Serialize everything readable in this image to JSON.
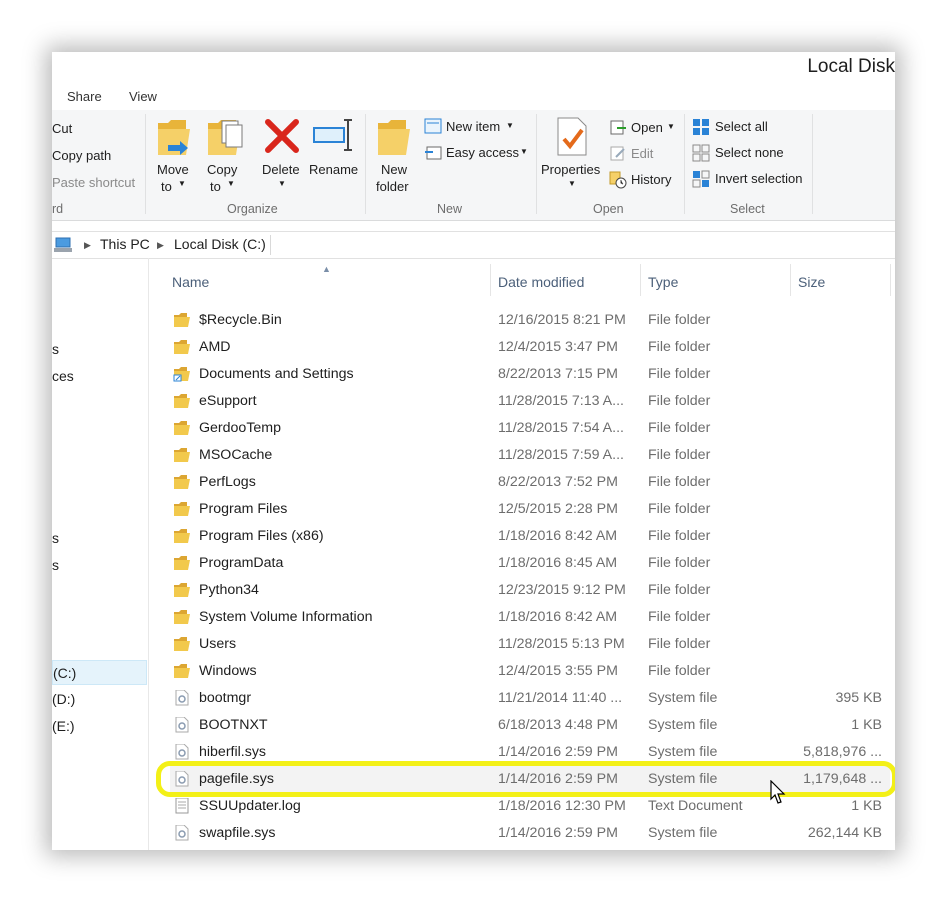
{
  "window": {
    "title": "Local Disk"
  },
  "tabs": [
    "Share",
    "View"
  ],
  "ribbon": {
    "clipboard": {
      "cut": "Cut",
      "copy_path": "Copy path",
      "paste_shortcut": "Paste shortcut",
      "group_label_fragment": "rd"
    },
    "organize": {
      "move_to": [
        "Move",
        "to"
      ],
      "copy_to": [
        "Copy",
        "to"
      ],
      "delete": "Delete",
      "rename": "Rename",
      "label": "Organize"
    },
    "new": {
      "new_folder": [
        "New",
        "folder"
      ],
      "new_item": "New item",
      "easy_access": "Easy access",
      "label": "New"
    },
    "open": {
      "properties": "Properties",
      "open": "Open",
      "edit": "Edit",
      "history": "History",
      "label": "Open"
    },
    "select": {
      "select_all": "Select all",
      "select_none": "Select none",
      "invert_selection": "Invert selection",
      "label": "Select"
    }
  },
  "address": {
    "this_pc": "This PC",
    "local_disk": "Local Disk (C:)"
  },
  "navpane": {
    "fragments": [
      "s",
      "ces",
      "s",
      "s"
    ],
    "drives": [
      "(C:)",
      "(D:)",
      "(E:)"
    ]
  },
  "columns": {
    "name": "Name",
    "date": "Date modified",
    "type": "Type",
    "size": "Size"
  },
  "files": [
    {
      "name": "$Recycle.Bin",
      "date": "12/16/2015 8:21 PM",
      "type": "File folder",
      "size": "",
      "icon": "folder-icon"
    },
    {
      "name": "AMD",
      "date": "12/4/2015 3:47 PM",
      "type": "File folder",
      "size": "",
      "icon": "folder-icon"
    },
    {
      "name": "Documents and Settings",
      "date": "8/22/2013 7:15 PM",
      "type": "File folder",
      "size": "",
      "icon": "shortcut-folder-icon"
    },
    {
      "name": "eSupport",
      "date": "11/28/2015 7:13 A...",
      "type": "File folder",
      "size": "",
      "icon": "folder-icon"
    },
    {
      "name": "GerdooTemp",
      "date": "11/28/2015 7:54 A...",
      "type": "File folder",
      "size": "",
      "icon": "folder-icon"
    },
    {
      "name": "MSOCache",
      "date": "11/28/2015 7:59 A...",
      "type": "File folder",
      "size": "",
      "icon": "folder-icon"
    },
    {
      "name": "PerfLogs",
      "date": "8/22/2013 7:52 PM",
      "type": "File folder",
      "size": "",
      "icon": "folder-icon"
    },
    {
      "name": "Program Files",
      "date": "12/5/2015 2:28 PM",
      "type": "File folder",
      "size": "",
      "icon": "folder-icon"
    },
    {
      "name": "Program Files (x86)",
      "date": "1/18/2016 8:42 AM",
      "type": "File folder",
      "size": "",
      "icon": "folder-icon"
    },
    {
      "name": "ProgramData",
      "date": "1/18/2016 8:45 AM",
      "type": "File folder",
      "size": "",
      "icon": "folder-icon"
    },
    {
      "name": "Python34",
      "date": "12/23/2015 9:12 PM",
      "type": "File folder",
      "size": "",
      "icon": "folder-icon"
    },
    {
      "name": "System Volume Information",
      "date": "1/18/2016 8:42 AM",
      "type": "File folder",
      "size": "",
      "icon": "folder-icon"
    },
    {
      "name": "Users",
      "date": "11/28/2015 5:13 PM",
      "type": "File folder",
      "size": "",
      "icon": "folder-icon"
    },
    {
      "name": "Windows",
      "date": "12/4/2015 3:55 PM",
      "type": "File folder",
      "size": "",
      "icon": "folder-icon"
    },
    {
      "name": "bootmgr",
      "date": "11/21/2014 11:40 ...",
      "type": "System file",
      "size": "395 KB",
      "icon": "system-file-icon"
    },
    {
      "name": "BOOTNXT",
      "date": "6/18/2013 4:48 PM",
      "type": "System file",
      "size": "1 KB",
      "icon": "system-file-icon"
    },
    {
      "name": "hiberfil.sys",
      "date": "1/14/2016 2:59 PM",
      "type": "System file",
      "size": "5,818,976 ...",
      "icon": "system-file-icon"
    },
    {
      "name": "pagefile.sys",
      "date": "1/14/2016 2:59 PM",
      "type": "System file",
      "size": "1,179,648 ...",
      "icon": "system-file-icon"
    },
    {
      "name": "SSUUpdater.log",
      "date": "1/18/2016 12:30 PM",
      "type": "Text Document",
      "size": "1 KB",
      "icon": "text-document-icon"
    },
    {
      "name": "swapfile.sys",
      "date": "1/14/2016 2:59 PM",
      "type": "System file",
      "size": "262,144 KB",
      "icon": "system-file-icon"
    }
  ],
  "colors": {
    "highlight": "#f3f017",
    "folder": "#f2c94c",
    "delete": "#d9261c"
  }
}
